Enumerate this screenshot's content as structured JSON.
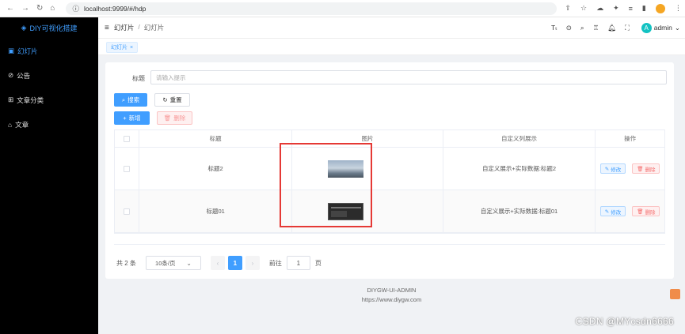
{
  "browser": {
    "url": "localhost:9999/#/hdp"
  },
  "sidebar": {
    "brand": "DIY可视化搭建",
    "items": [
      {
        "label": "幻灯片",
        "active": true
      },
      {
        "label": "公告"
      },
      {
        "label": "文章分类"
      },
      {
        "label": "文章"
      }
    ]
  },
  "header": {
    "breadcrumb": [
      "幻灯片",
      "幻灯片"
    ],
    "user_initial": "A",
    "user_name": "admin"
  },
  "tabs": [
    {
      "label": "幻灯片"
    }
  ],
  "filter": {
    "label": "标题",
    "placeholder": "请输入提示"
  },
  "buttons": {
    "search": "搜索",
    "reset": "重置",
    "add": "新增",
    "delete": "删除"
  },
  "table": {
    "columns": [
      "标题",
      "图片",
      "自定义列展示",
      "操作"
    ],
    "rows": [
      {
        "title": "标题2",
        "image": "sky",
        "custom": "自定义展示+实际数据:标题2",
        "edit": "修改",
        "del": "删除"
      },
      {
        "title": "标题01",
        "image": "dark",
        "custom": "自定义展示+实际数据:标题01",
        "edit": "修改",
        "del": "删除"
      }
    ]
  },
  "pagination": {
    "total": "共 2 条",
    "page_size": "10条/页",
    "current": "1",
    "goto_prefix": "前往",
    "goto_value": "1",
    "goto_suffix": "页"
  },
  "footer": {
    "line1": "DIYGW-UI-ADMIN",
    "line2": "https://www.diygw.com"
  },
  "watermark": "CSDN @MYcsdn6666",
  "colors": {
    "primary": "#409eff",
    "danger": "#f56c6c",
    "sidebar_bg": "#000000",
    "highlight_box": "#e53935"
  }
}
